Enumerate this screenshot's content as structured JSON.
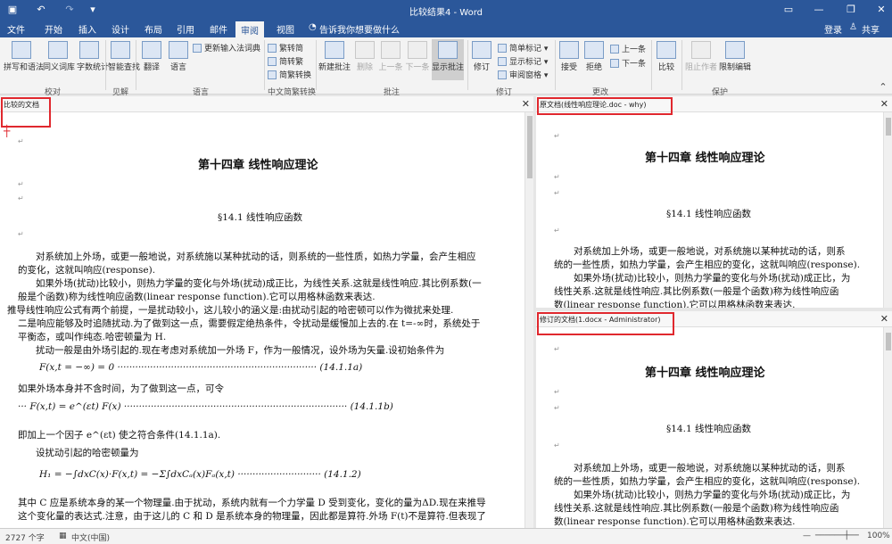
{
  "titlebar": {
    "title": "比较结果4 - Word",
    "login": "登录",
    "share": "共享"
  },
  "tabs": [
    "文件",
    "开始",
    "插入",
    "设计",
    "布局",
    "引用",
    "邮件",
    "审阅",
    "视图"
  ],
  "tell_me": "告诉我你想要做什么",
  "ribbon": {
    "spelling": "拼写和语法",
    "thesaurus": "同义词库",
    "wordcount": "字数统计",
    "smart_lookup": "智能查找",
    "translate": "翻译",
    "language": "语言",
    "update_ime": "更新输入法词典",
    "trad_simp": "繁转简",
    "simp_trad": "简转繁",
    "convert": "简繁转换",
    "new_comment": "新建批注",
    "delete": "删除",
    "prev": "上一条",
    "next": "下一条",
    "show_comments": "显示批注",
    "track": "修订",
    "simple_markup": "简单标记",
    "show_markup": "显示标记",
    "reviewing_pane": "审阅窗格",
    "accept": "接受",
    "reject": "拒绝",
    "prev_change": "上一条",
    "next_change": "下一条",
    "compare": "比较",
    "block_authors": "阻止作者",
    "restrict": "限制编辑",
    "groups": {
      "proofing": "校对",
      "insights": "见解",
      "language": "语言",
      "chinese": "中文简繁转换",
      "comments": "批注",
      "tracking": "修订",
      "changes": "更改",
      "protect": "保护"
    }
  },
  "panes": {
    "compared_title": "比较的文档",
    "original_title": "原文档(线性响应理论.doc - why)",
    "revised_title": "修订的文档(1.docx - Administrator)"
  },
  "doc": {
    "chapter": "第十四章 线性响应理论",
    "section": "§14.1 线性响应函数",
    "p1": "对系统加上外场，或更一般地说，对系统施以某种扰动的话，则系统的一些性质，如热力学量，会产生相应",
    "p1b": "的变化，这就叫响应(response).",
    "p2": "如果外场(扰动)比较小，则热力学量的变化与外场(扰动)成正比，为线性关系.这就是线性响应.其比例系数(一",
    "p2b": "般是个函数)称为线性响应函数(linear response function).它可以用格林函数来表达.",
    "p3": "推导线性响应公式有两个前提，一是扰动较小，这儿较小的涵义是:由扰动引起的哈密顿可以作为微扰来处理.",
    "p3b": "二是响应能够及时追随扰动.为了做到这一点，需要假定绝热条件，令扰动是缓慢加上去的.在 t=-∞时，系统处于",
    "p3c": "平衡态，或叫作纯态.哈密顿量为 H.",
    "p4": "扰动一般是由外场引起的.现在考虑对系统加一外场 F，作为一般情况，设外场为矢量.设初始条件为",
    "eq1": "F(x,t = −∞) = 0 ··································································· (14.1.1a)",
    "p5": "如果外场本身并不含时间，为了做到这一点，可令",
    "eq2": "··· F(x,t) = e^(εt) F(x) ··········································································· (14.1.1b)",
    "p6": "即加上一个因子 e^(εt) 使之符合条件(14.1.1a).",
    "p7": "设扰动引起的哈密顿量为",
    "eq3": "H₁ = −∫dxC(x)·F(x,t) = −Σ∫dxCₐ(x)Fₐ(x,t) ···························· (14.1.2)",
    "p8": "其中 C 应是系统本身的某一个物理量.由于扰动，系统内就有一个力学量 D 受到变化，变化的量为ΔD.现在来推导",
    "p8b": "这个变化量的表达式.注意，由于这儿的 C 和 D 是系统本身的物理量，因此都是算符.外场 F(t)不是算符.但表现了",
    "r1": "对系统加上外场，或更一般地说，对系统施以某种扰动的话，则系",
    "r1b": "统的一些性质，如热力学量，会产生相应的变化，这就叫响应(response).",
    "r2": "如果外场(扰动)比较小，则热力学量的变化与外场(扰动)成正比，为",
    "r2b": "线性关系.这就是线性响应.其比例系数(一般是个函数)称为线性响应函",
    "r2c": "数(linear response function).它可以用格林函数来表达."
  },
  "status": {
    "words": "2727 个字",
    "lang": "中文(中国)",
    "zoom": "100%"
  }
}
